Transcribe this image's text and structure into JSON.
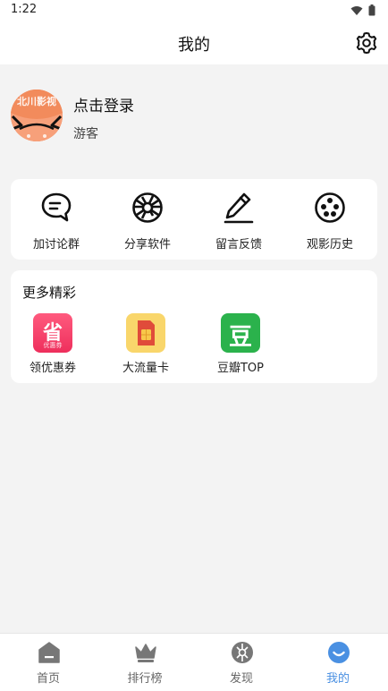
{
  "status_bar": {
    "time": "1:22"
  },
  "header": {
    "title": "我的"
  },
  "profile": {
    "avatar_text": "北川影视",
    "login_label": "点击登录",
    "user_role": "游客"
  },
  "actions": [
    {
      "label": "加讨论群",
      "icon": "chat-icon"
    },
    {
      "label": "分享软件",
      "icon": "aperture-icon"
    },
    {
      "label": "留言反馈",
      "icon": "pen-icon"
    },
    {
      "label": "观影历史",
      "icon": "film-reel-icon"
    }
  ],
  "more": {
    "title": "更多精彩",
    "items": [
      {
        "label": "领优惠券",
        "icon_text": "省",
        "icon_subtext": "优惠券",
        "icon": "coupon-icon"
      },
      {
        "label": "大流量卡",
        "icon": "sim-card-icon"
      },
      {
        "label": "豆瓣TOP",
        "icon_text": "豆",
        "icon": "douban-icon"
      }
    ]
  },
  "tabbar": {
    "active": "我的",
    "items": [
      {
        "label": "首页",
        "icon": "home-icon"
      },
      {
        "label": "排行榜",
        "icon": "crown-icon"
      },
      {
        "label": "发现",
        "icon": "discover-icon"
      },
      {
        "label": "我的",
        "icon": "smile-icon"
      }
    ]
  },
  "colors": {
    "accent": "#4a90e2",
    "background": "#f3f3f3",
    "coupon": "#f23f6c",
    "douban": "#2bb24c",
    "sim": "#f7c948",
    "avatar": "#f28b5c"
  }
}
